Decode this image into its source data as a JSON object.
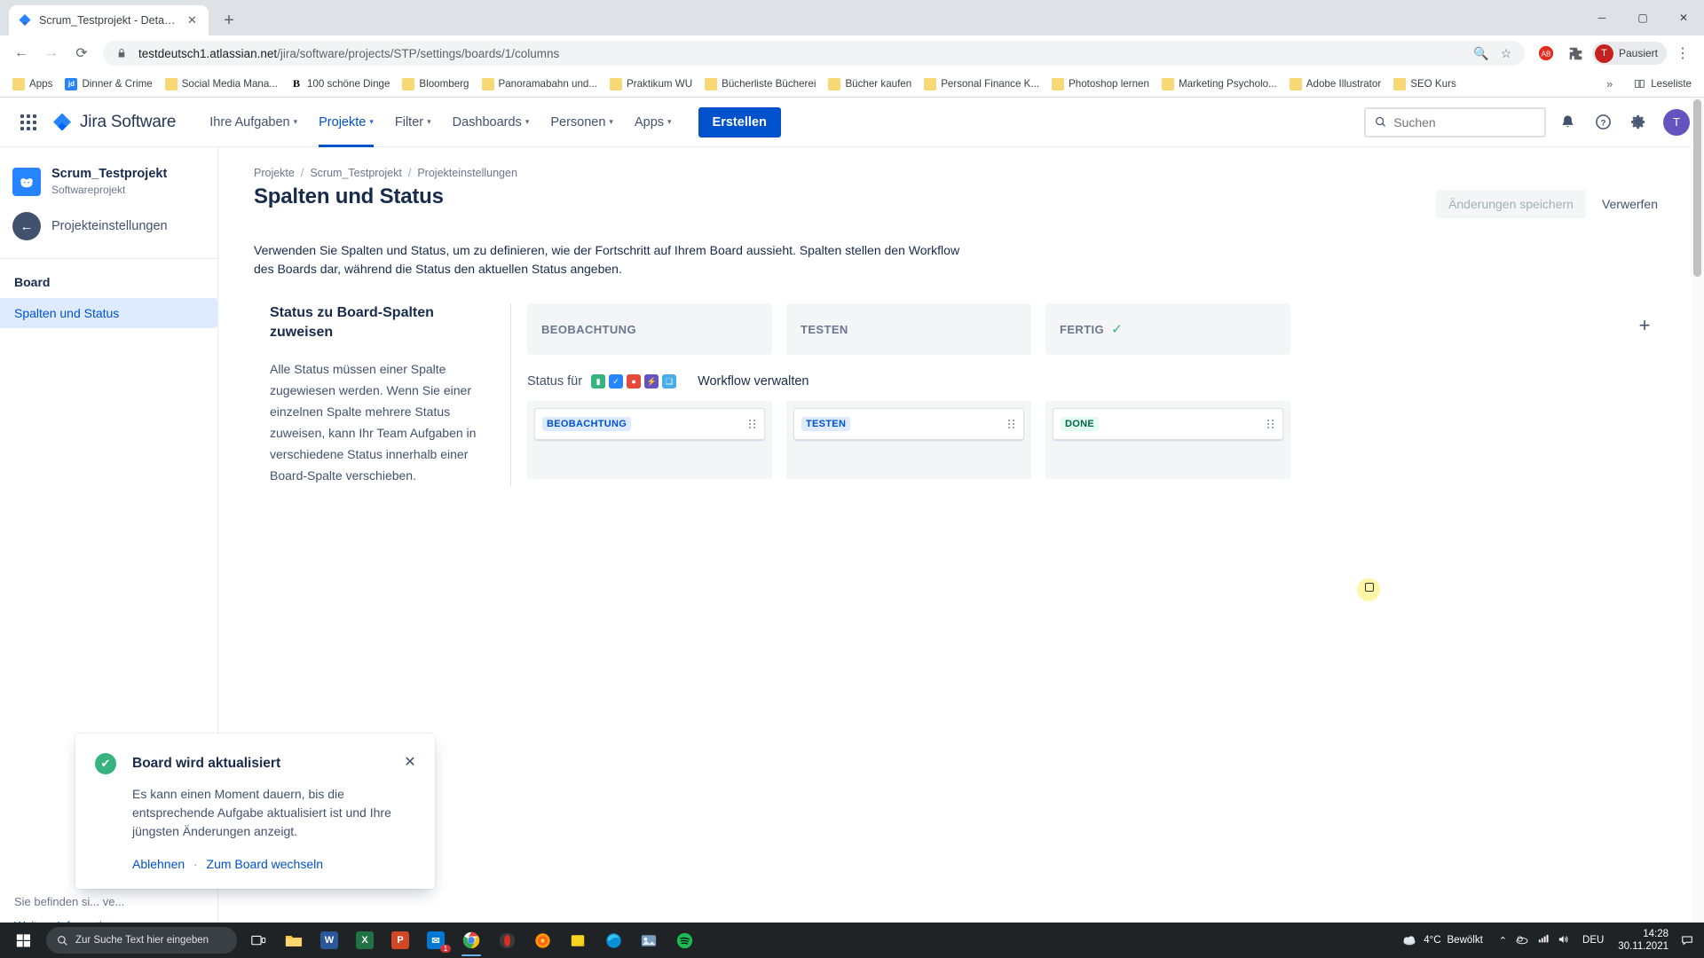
{
  "browser": {
    "tab": {
      "title": "Scrum_Testprojekt - Details - Jira",
      "close_label": "✕",
      "favicon": "jira-favicon"
    },
    "newtab_label": "+",
    "window_controls": {
      "minimize": "─",
      "maximize": "▢",
      "close": "✕"
    },
    "nav": {
      "back": "←",
      "forward": "→",
      "reload": "⟳"
    },
    "omnibox": {
      "lock_icon": "lock-icon",
      "url_domain": "testdeutsch1.atlassian.net",
      "url_path": "/jira/software/projects/STP/settings/boards/1/columns",
      "zoom_icon": "🔍",
      "star_icon": "☆"
    },
    "extensions": {
      "ext_icon": "extensions-puzzle-icon",
      "ad_icon": "adblock-icon"
    },
    "profile": {
      "label": "Pausiert",
      "initial": "T"
    },
    "menu_icon": "⋮",
    "bookmarks": [
      {
        "label": "Apps",
        "icon": "apps-grid"
      },
      {
        "label": "Dinner & Crime",
        "icon": "jd"
      },
      {
        "label": "Social Media Mana...",
        "icon": "folder"
      },
      {
        "label": "100 schöne Dinge",
        "icon": "bb"
      },
      {
        "label": "Bloomberg",
        "icon": "folder"
      },
      {
        "label": "Panoramabahn und...",
        "icon": "folder"
      },
      {
        "label": "Praktikum WU",
        "icon": "folder"
      },
      {
        "label": "Bücherliste Bücherei",
        "icon": "folder"
      },
      {
        "label": "Bücher kaufen",
        "icon": "folder"
      },
      {
        "label": "Personal Finance K...",
        "icon": "folder"
      },
      {
        "label": "Photoshop lernen",
        "icon": "folder"
      },
      {
        "label": "Marketing Psycholo...",
        "icon": "folder"
      },
      {
        "label": "Adobe Illustrator",
        "icon": "folder"
      },
      {
        "label": "SEO Kurs",
        "icon": "folder"
      }
    ],
    "bookmarks_overflow": "»",
    "reading_list": "Leseliste"
  },
  "jira": {
    "brand": "Jira Software",
    "app_switcher": "app-switcher",
    "nav_items": [
      {
        "label": "Ihre Aufgaben",
        "has_caret": true,
        "active": false
      },
      {
        "label": "Projekte",
        "has_caret": true,
        "active": true
      },
      {
        "label": "Filter",
        "has_caret": true,
        "active": false
      },
      {
        "label": "Dashboards",
        "has_caret": true,
        "active": false
      },
      {
        "label": "Personen",
        "has_caret": true,
        "active": false
      },
      {
        "label": "Apps",
        "has_caret": true,
        "active": false
      }
    ],
    "create_button": "Erstellen",
    "search_placeholder": "Suchen",
    "icons": {
      "notifications": "bell-icon",
      "help": "help-icon",
      "settings": "gear-icon"
    },
    "avatar_initial": "T"
  },
  "sidebar": {
    "project_name": "Scrum_Testprojekt",
    "project_type": "Softwareprojekt",
    "back_label": "Projekteinstellungen",
    "section_label": "Board",
    "items": [
      {
        "label": "Spalten und Status",
        "active": true
      }
    ],
    "footer_text": "Sie befinden si...\nve...",
    "footer_link": "Weitere Informationen"
  },
  "main": {
    "breadcrumb": [
      "Projekte",
      "Scrum_Testprojekt",
      "Projekteinstellungen"
    ],
    "breadcrumb_sep": "/",
    "page_title": "Spalten und Status",
    "save_button": "Änderungen speichern",
    "discard_button": "Verwerfen",
    "description": "Verwenden Sie Spalten und Status, um zu definieren, wie der Fortschritt auf Ihrem Board aussieht. Spalten stellen den Workflow des Boards dar, während die Status den aktuellen Status angeben.",
    "info_panel": {
      "title": "Status zu Board-Spalten zuweisen",
      "body": "Alle Status müssen einer Spalte zugewiesen werden. Wenn Sie einer einzelnen Spalte mehrere Status zuweisen, kann Ihr Team Aufgaben in verschiedene Status innerhalb einer Board-Spalte verschieben."
    },
    "add_column_icon": "+",
    "status_for_label": "Status für",
    "workflow_link": "Workflow verwalten",
    "issue_type_icons": [
      {
        "name": "story-icon",
        "color": "#36b37e",
        "glyph": "▮"
      },
      {
        "name": "task-icon",
        "color": "#2684ff",
        "glyph": "✓"
      },
      {
        "name": "bug-icon",
        "color": "#e5493a",
        "glyph": "●"
      },
      {
        "name": "epic-icon",
        "color": "#6554c0",
        "glyph": "⚡"
      },
      {
        "name": "subtask-icon",
        "color": "#4bade8",
        "glyph": "❏"
      }
    ],
    "columns": [
      {
        "header": "BEOBACHTUNG",
        "done": false,
        "statuses": [
          {
            "label": "BEOBACHTUNG",
            "color": "blue"
          }
        ]
      },
      {
        "header": "TESTEN",
        "done": false,
        "statuses": [
          {
            "label": "TESTEN",
            "color": "blue"
          }
        ]
      },
      {
        "header": "FERTIG",
        "done": true,
        "done_icon": "✓",
        "statuses": [
          {
            "label": "DONE",
            "color": "green"
          }
        ]
      }
    ]
  },
  "toast": {
    "icon": "success-check-icon",
    "title": "Board wird aktualisiert",
    "body": "Es kann einen Moment dauern, bis die entsprechende Aufgabe aktualisiert ist und Ihre jüngsten Änderungen anzeigt.",
    "decline": "Ablehnen",
    "separator": "·",
    "switch": "Zum Board wechseln",
    "close_icon": "✕"
  },
  "taskbar": {
    "start_icon": "windows-start-icon",
    "search_placeholder": "Zur Suche Text hier eingeben",
    "taskview_icon": "task-view-icon",
    "apps": [
      {
        "name": "file-explorer",
        "label": "",
        "color": "#ffc83d"
      },
      {
        "name": "word",
        "label": "W",
        "color": "#2b579a"
      },
      {
        "name": "excel",
        "label": "X",
        "color": "#217346"
      },
      {
        "name": "powerpoint",
        "label": "P",
        "color": "#d24726"
      },
      {
        "name": "mail",
        "label": "✉",
        "color": "#0078d4",
        "badge": "1"
      },
      {
        "name": "chrome",
        "label": "",
        "color": "#ffffff",
        "active": true
      },
      {
        "name": "opera-gx",
        "label": "",
        "color": "#1f2326"
      },
      {
        "name": "firefox",
        "label": "",
        "color": "#ff7139"
      },
      {
        "name": "sticky-notes",
        "label": "",
        "color": "#f9d423"
      },
      {
        "name": "edge",
        "label": "",
        "color": "#0b8fd4"
      },
      {
        "name": "photos",
        "label": "",
        "color": "#7a9ec2"
      },
      {
        "name": "spotify",
        "label": "",
        "color": "#1db954"
      }
    ],
    "weather": {
      "temp": "4°C",
      "desc": "Bewölkt",
      "icon": "cloud-icon"
    },
    "tray": {
      "chevron": "⌃",
      "onedrive": "☁",
      "network": "📶",
      "volume": "🔊"
    },
    "language": "DEU",
    "time": "14:28",
    "date": "30.11.2021",
    "notification_icon": "notification-icon"
  }
}
